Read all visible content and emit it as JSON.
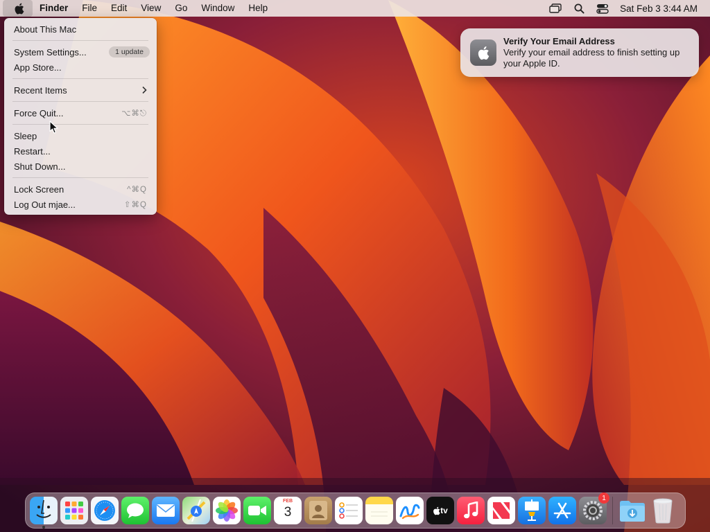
{
  "menubar": {
    "app_name": "Finder",
    "menus": [
      "File",
      "Edit",
      "View",
      "Go",
      "Window",
      "Help"
    ],
    "clock": "Sat Feb 3  3:44 AM"
  },
  "apple_menu": {
    "about": "About This Mac",
    "system_settings": "System Settings...",
    "system_settings_badge": "1 update",
    "app_store": "App Store...",
    "recent_items": "Recent Items",
    "force_quit": "Force Quit...",
    "force_quit_shortcut": "⌥⌘⎋",
    "sleep": "Sleep",
    "restart": "Restart...",
    "shut_down": "Shut Down...",
    "lock_screen": "Lock Screen",
    "lock_screen_shortcut": "^⌘Q",
    "log_out": "Log Out mjae...",
    "log_out_shortcut": "⇧⌘Q"
  },
  "notification": {
    "title": "Verify Your Email Address",
    "body": "Verify your email address to finish setting up your Apple ID."
  },
  "dock": {
    "calendar_month": "FEB",
    "calendar_day": "3",
    "system_settings_badge": "1",
    "tv_label": "tv"
  },
  "colors": {
    "badge_red": "#f0383a",
    "wallpaper_orange": "#f26a1b",
    "wallpaper_purple": "#5c1240"
  }
}
